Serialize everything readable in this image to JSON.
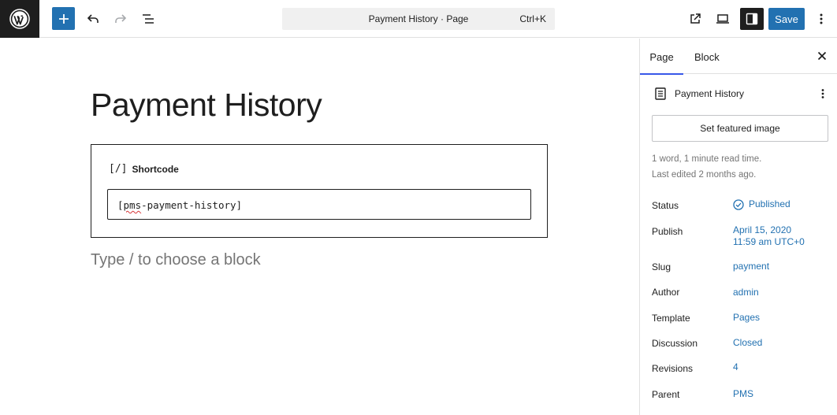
{
  "toolbar": {
    "logo_icon": "wordpress-logo-icon",
    "add_icon": "plus-icon",
    "undo_icon": "undo-icon",
    "redo_icon": "redo-icon",
    "list_view_icon": "list-view-icon",
    "view_icon": "external-link-icon",
    "preview_icon": "laptop-icon",
    "settings_icon": "sidebar-toggle-icon",
    "save_label": "Save",
    "options_icon": "more-vertical-icon",
    "accent_color": "#2271b1"
  },
  "command_bar": {
    "title": "Payment History · Page",
    "shortcut": "Ctrl+K"
  },
  "editor": {
    "post_title": "Payment History",
    "shortcode_block": {
      "icon_glyph": "[/]",
      "label": "Shortcode",
      "value_prefix": "[",
      "value_misspelled": "pms",
      "value_suffix": "-payment-history]"
    },
    "placeholder": "Type / to choose a block"
  },
  "sidebar": {
    "tabs": [
      {
        "label": "Page",
        "active": true
      },
      {
        "label": "Block",
        "active": false
      }
    ],
    "close_icon": "close-icon",
    "document": {
      "icon": "page-icon",
      "title": "Payment History",
      "more_icon": "more-vertical-icon"
    },
    "featured_image_label": "Set featured image",
    "meta": {
      "read_time": "1 word, 1 minute read time.",
      "last_edited": "Last edited 2 months ago."
    },
    "properties": [
      {
        "label": "Status",
        "value": "Published",
        "icon": "published-check-icon"
      },
      {
        "label": "Publish",
        "value": "April 15, 2020",
        "value2": "11:59 am UTC+0"
      },
      {
        "label": "Slug",
        "value": "payment"
      },
      {
        "label": "Author",
        "value": "admin"
      },
      {
        "label": "Template",
        "value": "Pages"
      },
      {
        "label": "Discussion",
        "value": "Closed"
      },
      {
        "label": "Revisions",
        "value": "4"
      },
      {
        "label": "Parent",
        "value": "PMS"
      }
    ]
  }
}
